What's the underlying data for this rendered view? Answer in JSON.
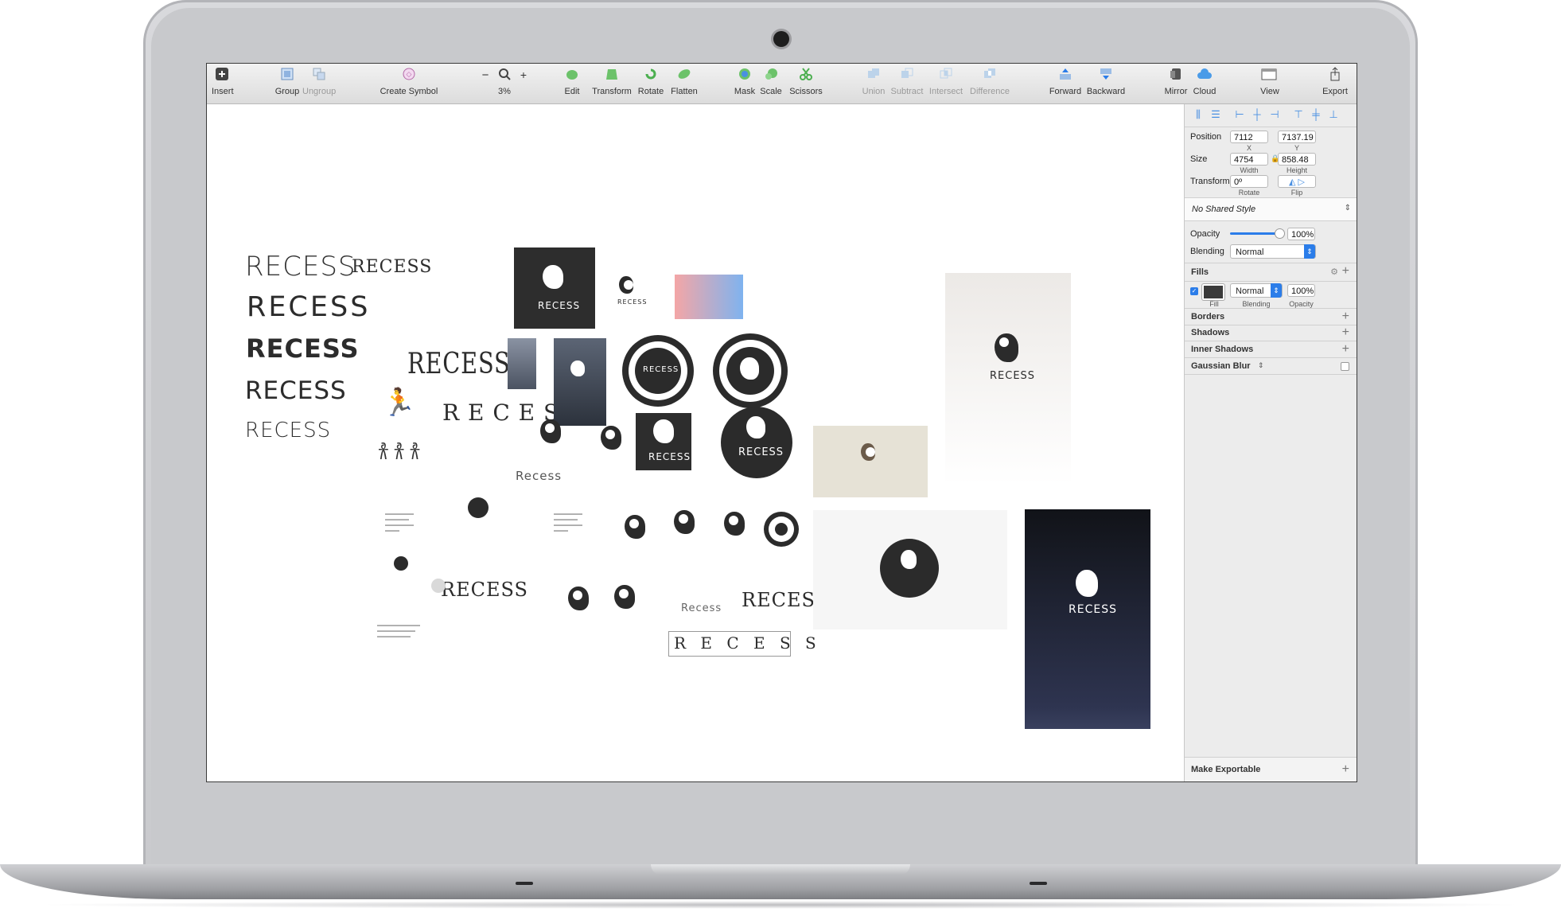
{
  "toolbar": {
    "items": [
      {
        "label": "Insert",
        "icon": "plus-square-icon"
      },
      {
        "label": "Group",
        "icon": "group-icon"
      },
      {
        "label": "Ungroup",
        "icon": "ungroup-icon"
      },
      {
        "label": "Create Symbol",
        "icon": "symbol-icon"
      },
      {
        "label": "3%",
        "icon": "zoom-icon"
      },
      {
        "label": "Edit",
        "icon": "edit-icon"
      },
      {
        "label": "Transform",
        "icon": "transform-icon"
      },
      {
        "label": "Rotate",
        "icon": "rotate-icon"
      },
      {
        "label": "Flatten",
        "icon": "flatten-icon"
      },
      {
        "label": "Mask",
        "icon": "mask-icon"
      },
      {
        "label": "Scale",
        "icon": "scale-icon"
      },
      {
        "label": "Scissors",
        "icon": "scissors-icon"
      },
      {
        "label": "Union",
        "icon": "union-icon"
      },
      {
        "label": "Subtract",
        "icon": "subtract-icon"
      },
      {
        "label": "Intersect",
        "icon": "intersect-icon"
      },
      {
        "label": "Difference",
        "icon": "difference-icon"
      },
      {
        "label": "Forward",
        "icon": "forward-icon"
      },
      {
        "label": "Backward",
        "icon": "backward-icon"
      },
      {
        "label": "Mirror",
        "icon": "mirror-icon"
      },
      {
        "label": "Cloud",
        "icon": "cloud-icon"
      },
      {
        "label": "View",
        "icon": "view-icon"
      },
      {
        "label": "Export",
        "icon": "export-icon"
      }
    ],
    "zoom_minus": "−",
    "zoom_plus": "+"
  },
  "inspector": {
    "position_label": "Position",
    "position_x": "7112",
    "position_y": "7137.19",
    "x_label": "X",
    "y_label": "Y",
    "size_label": "Size",
    "width": "4754",
    "height": "858.48",
    "width_label": "Width",
    "height_label": "Height",
    "transform_label": "Transform",
    "rotate": "0º",
    "rotate_label": "Rotate",
    "flip_label": "Flip",
    "shared_style": "No Shared Style",
    "opacity_label": "Opacity",
    "opacity_value": "100%",
    "opacity_level": 1.0,
    "blending_label": "Blending",
    "blending_value": "Normal",
    "fills_label": "Fills",
    "fill_color": "#3a3a3a",
    "fill_blending": "Normal",
    "fill_opacity": "100%",
    "fill_sub": "Fill",
    "fill_blending_sub": "Blending",
    "fill_opacity_sub": "Opacity",
    "borders_label": "Borders",
    "shadows_label": "Shadows",
    "inner_shadows_label": "Inner Shadows",
    "gaussian_blur_label": "Gaussian Blur",
    "make_exportable_label": "Make Exportable",
    "accent": "#2b7de9"
  },
  "canvas": {
    "wordmarks": [
      "RECESS",
      "RECESS",
      "RECESS",
      "RECESS",
      "RECESS",
      "RECESS",
      "RECESS",
      "R E C E S S",
      "Recess",
      "RECESS",
      "Recess",
      "R E C E S S"
    ],
    "logo_label": "RECESS"
  }
}
